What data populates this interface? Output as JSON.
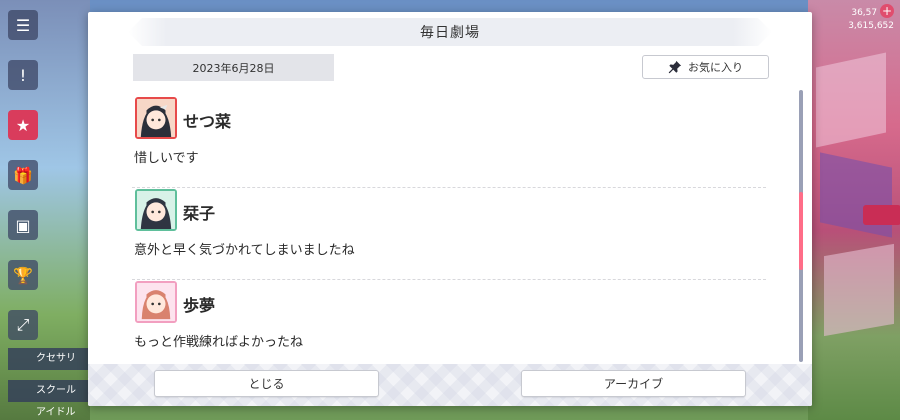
{
  "dialog": {
    "title": "毎日劇場",
    "date": "2023年6月28日",
    "favorite_label": "お気に入り",
    "close_label": "とじる",
    "archive_label": "アーカイブ"
  },
  "entries": [
    {
      "speaker": "せつ菜",
      "text": "惜しいです",
      "avatar_color": "#e74a4a"
    },
    {
      "speaker": "栞子",
      "text": "意外と早く気づかれてしまいましたね",
      "avatar_color": "#5fbf9b"
    },
    {
      "speaker": "歩夢",
      "text": "もっと作戦練ればよかったね",
      "avatar_color": "#f29fc0"
    }
  ],
  "background": {
    "side_labels": [
      "クセサリ",
      "スクール\nアイドル"
    ],
    "top_right_lines": [
      "36,57",
      "3,615,652"
    ]
  },
  "colors": {
    "scroll_thumb": "#ff6d88",
    "accent_pink": "#e04d6e"
  }
}
